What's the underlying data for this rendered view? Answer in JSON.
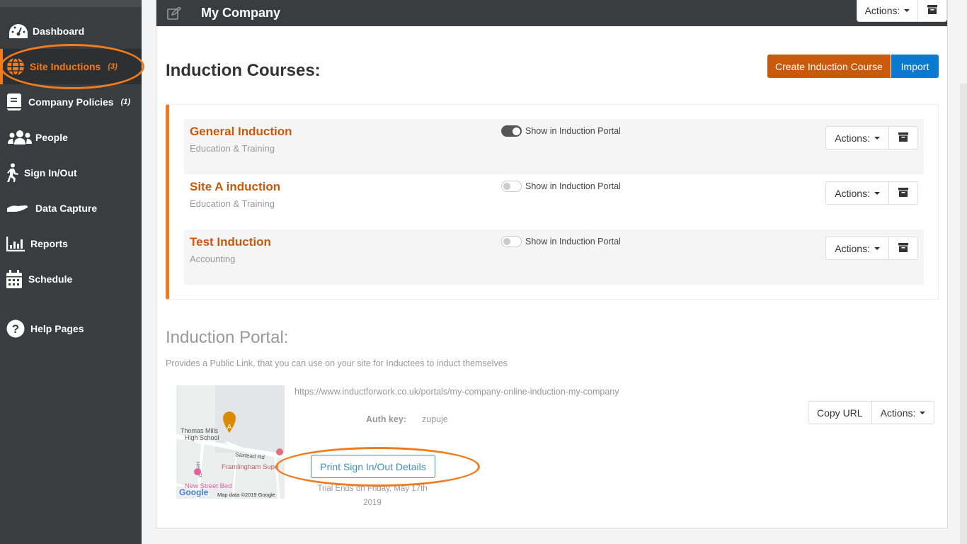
{
  "sidebar": {
    "items": [
      {
        "label": "Dashboard",
        "icon": "dashboard-gauge-icon",
        "count": ""
      },
      {
        "label": "Site Inductions",
        "icon": "globe-icon",
        "count": "(3)",
        "active": true
      },
      {
        "label": "Company Policies",
        "icon": "book-icon",
        "count": "(1)"
      },
      {
        "label": "People",
        "icon": "users-icon",
        "count": ""
      },
      {
        "label": "Sign In/Out",
        "icon": "walking-person-icon",
        "count": ""
      },
      {
        "label": "Data Capture",
        "icon": "hand-icon",
        "count": ""
      },
      {
        "label": "Reports",
        "icon": "bar-chart-icon",
        "count": ""
      },
      {
        "label": "Schedule",
        "icon": "calendar-icon",
        "count": ""
      },
      {
        "label": "Help Pages",
        "icon": "question-circle-icon",
        "count": ""
      }
    ]
  },
  "header": {
    "title": "My Company",
    "actions_label": "Actions:"
  },
  "courses": {
    "title": "Induction Courses:",
    "create_label": "Create Induction Course",
    "import_label": "Import",
    "items": [
      {
        "name": "General Induction",
        "category": "Education & Training",
        "toggle_label": "Show in Induction Portal",
        "show_in_portal": true,
        "actions_label": "Actions:"
      },
      {
        "name": "Site A induction",
        "category": "Education & Training",
        "toggle_label": "Show in Induction Portal",
        "show_in_portal": false,
        "actions_label": "Actions:"
      },
      {
        "name": "Test Induction",
        "category": "Accounting",
        "toggle_label": "Show in Induction Portal",
        "show_in_portal": false,
        "actions_label": "Actions:"
      }
    ]
  },
  "portal": {
    "title": "Induction Portal:",
    "description": "Provides a Public Link, that you can use on your site for Inductees to induct themselves",
    "url": "https://www.inductforwork.co.uk/portals/my-company-online-induction-my-company",
    "auth_label": "Auth key:",
    "auth_value": "zupuje",
    "print_label": "Print Sign In/Out Details",
    "trial_text_line1": "Trial Ends on Friday, May 17th",
    "trial_text_line2": "2019",
    "copy_label": "Copy URL",
    "actions_label": "Actions:",
    "map": {
      "marker": "A",
      "labels": [
        "Thomas Mills",
        "High School",
        "Saxtead Rd",
        "New St",
        "Framlingham Supe",
        "New Street Bed"
      ],
      "attribution": "Map data ©2019 Google",
      "logo": "Google"
    }
  },
  "colors": {
    "accent_orange": "#f07c1f",
    "course_title": "#c85a09",
    "import_blue": "#0a7ad1",
    "sidebar_bg": "#3a3d3f"
  }
}
